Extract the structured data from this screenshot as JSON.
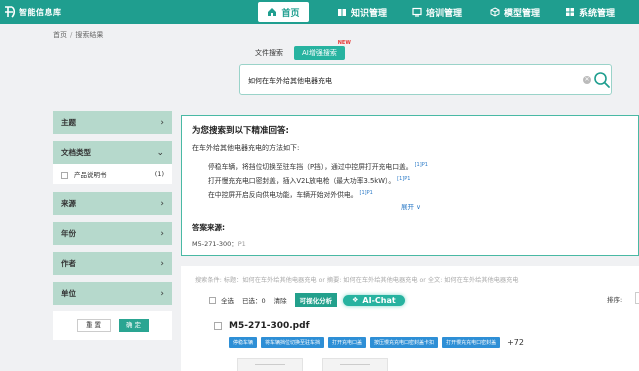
{
  "brand": {
    "name": "智能信息库"
  },
  "nav": {
    "home": "首页",
    "knowledge": "知识管理",
    "training": "培训管理",
    "model": "模型管理",
    "system": "系统管理"
  },
  "breadcrumb": {
    "root": "首页",
    "sep": "/",
    "current": "搜索结果"
  },
  "search": {
    "tab_file": "文件搜索",
    "tab_ai": "AI增强搜索",
    "new_badge": "NEW",
    "query": "如何在车外给其他电器充电"
  },
  "sidebar": {
    "facets": [
      {
        "label": "主题"
      },
      {
        "label": "文档类型",
        "items": [
          {
            "label": "产品说明书",
            "count": "(1)"
          }
        ]
      },
      {
        "label": "来源"
      },
      {
        "label": "年份"
      },
      {
        "label": "作者"
      },
      {
        "label": "单位"
      }
    ],
    "reset_label": "重 置",
    "ok_label": "确 定"
  },
  "answer": {
    "title": "为您搜索到以下精准回答:",
    "intro": "在车外给其他电器充电的方法如下:",
    "lines": [
      {
        "text": "停稳车辆，将挡位切换至驻车挡（P挡），通过中控屏打开充电口盖。",
        "ref": "[1]P1"
      },
      {
        "text": "打开慢充充电口密封盖，插入V2L放电枪（最大功率3.5kW）。",
        "ref": "[1]P1"
      },
      {
        "text": "在中控屏开启反向供电功能，车辆开始对外供电。",
        "ref": "[1]P1"
      }
    ],
    "expand": "展开 ∨",
    "source_label": "答案来源:",
    "source_doc": "M5-271-300：",
    "source_page": "P1"
  },
  "results": {
    "conditions": "搜索条件: 标题：如何在车外给其他电器充电 or 摘要: 如何在车外给其他电器充电 or 全文: 如何在车外给其他电器充电",
    "select_all": "全选",
    "selected": "已选：0",
    "clear": "清除",
    "visual_analysis": "可视化分析",
    "ai_chat": "AI-Chat",
    "sort_label": "排序:",
    "docs": [
      {
        "title": "M5-271-300.pdf",
        "tags": [
          "停稳车辆",
          "将车辆挡位切换至驻车挡",
          "打开充电口盖",
          "按压慢充充电口密封盖卡扣",
          "打开慢充充电口密封盖"
        ],
        "more": "+72"
      }
    ]
  },
  "colors": {
    "primary": "#1f9e8f",
    "facet_bg": "#b6d9cc",
    "tag": "#2e8fd6",
    "ref": "#2a79c7"
  }
}
